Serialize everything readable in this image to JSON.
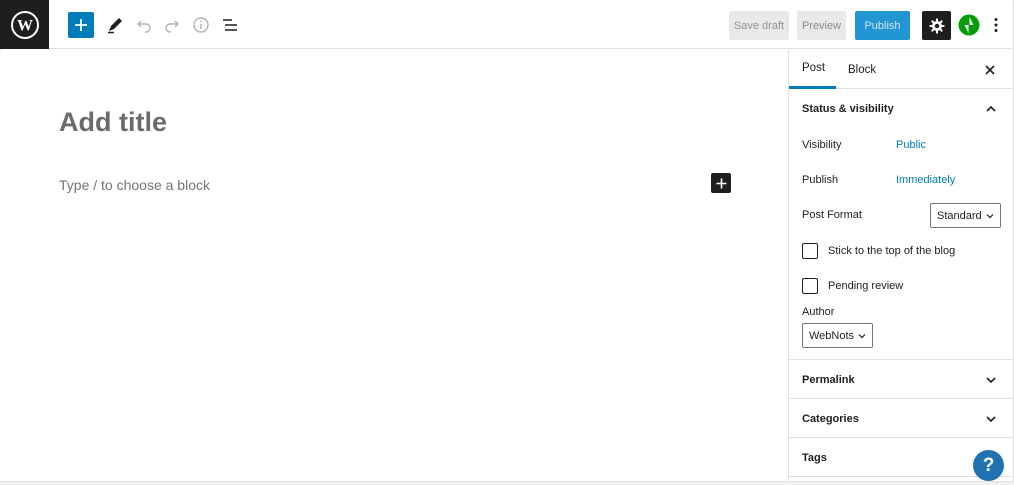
{
  "toolbar": {
    "save_draft": "Save draft",
    "preview": "Preview",
    "publish": "Publish",
    "accent_color": "#007cba",
    "jetpack_color": "#069e08"
  },
  "editor": {
    "title_placeholder": "Add title",
    "block_placeholder": "Type / to choose a block"
  },
  "sidebar": {
    "tabs": [
      {
        "label": "Post",
        "active": true
      },
      {
        "label": "Block",
        "active": false
      }
    ],
    "status_panel": {
      "title": "Status & visibility",
      "visibility_label": "Visibility",
      "visibility_value": "Public",
      "publish_label": "Publish",
      "publish_value": "Immediately",
      "post_format_label": "Post Format",
      "post_format_value": "Standard",
      "sticky_label": "Stick to the top of the blog",
      "pending_label": "Pending review",
      "author_label": "Author",
      "author_value": "WebNots"
    },
    "panels": [
      {
        "title": "Permalink"
      },
      {
        "title": "Categories"
      },
      {
        "title": "Tags"
      }
    ]
  },
  "help": {
    "symbol": "?"
  }
}
